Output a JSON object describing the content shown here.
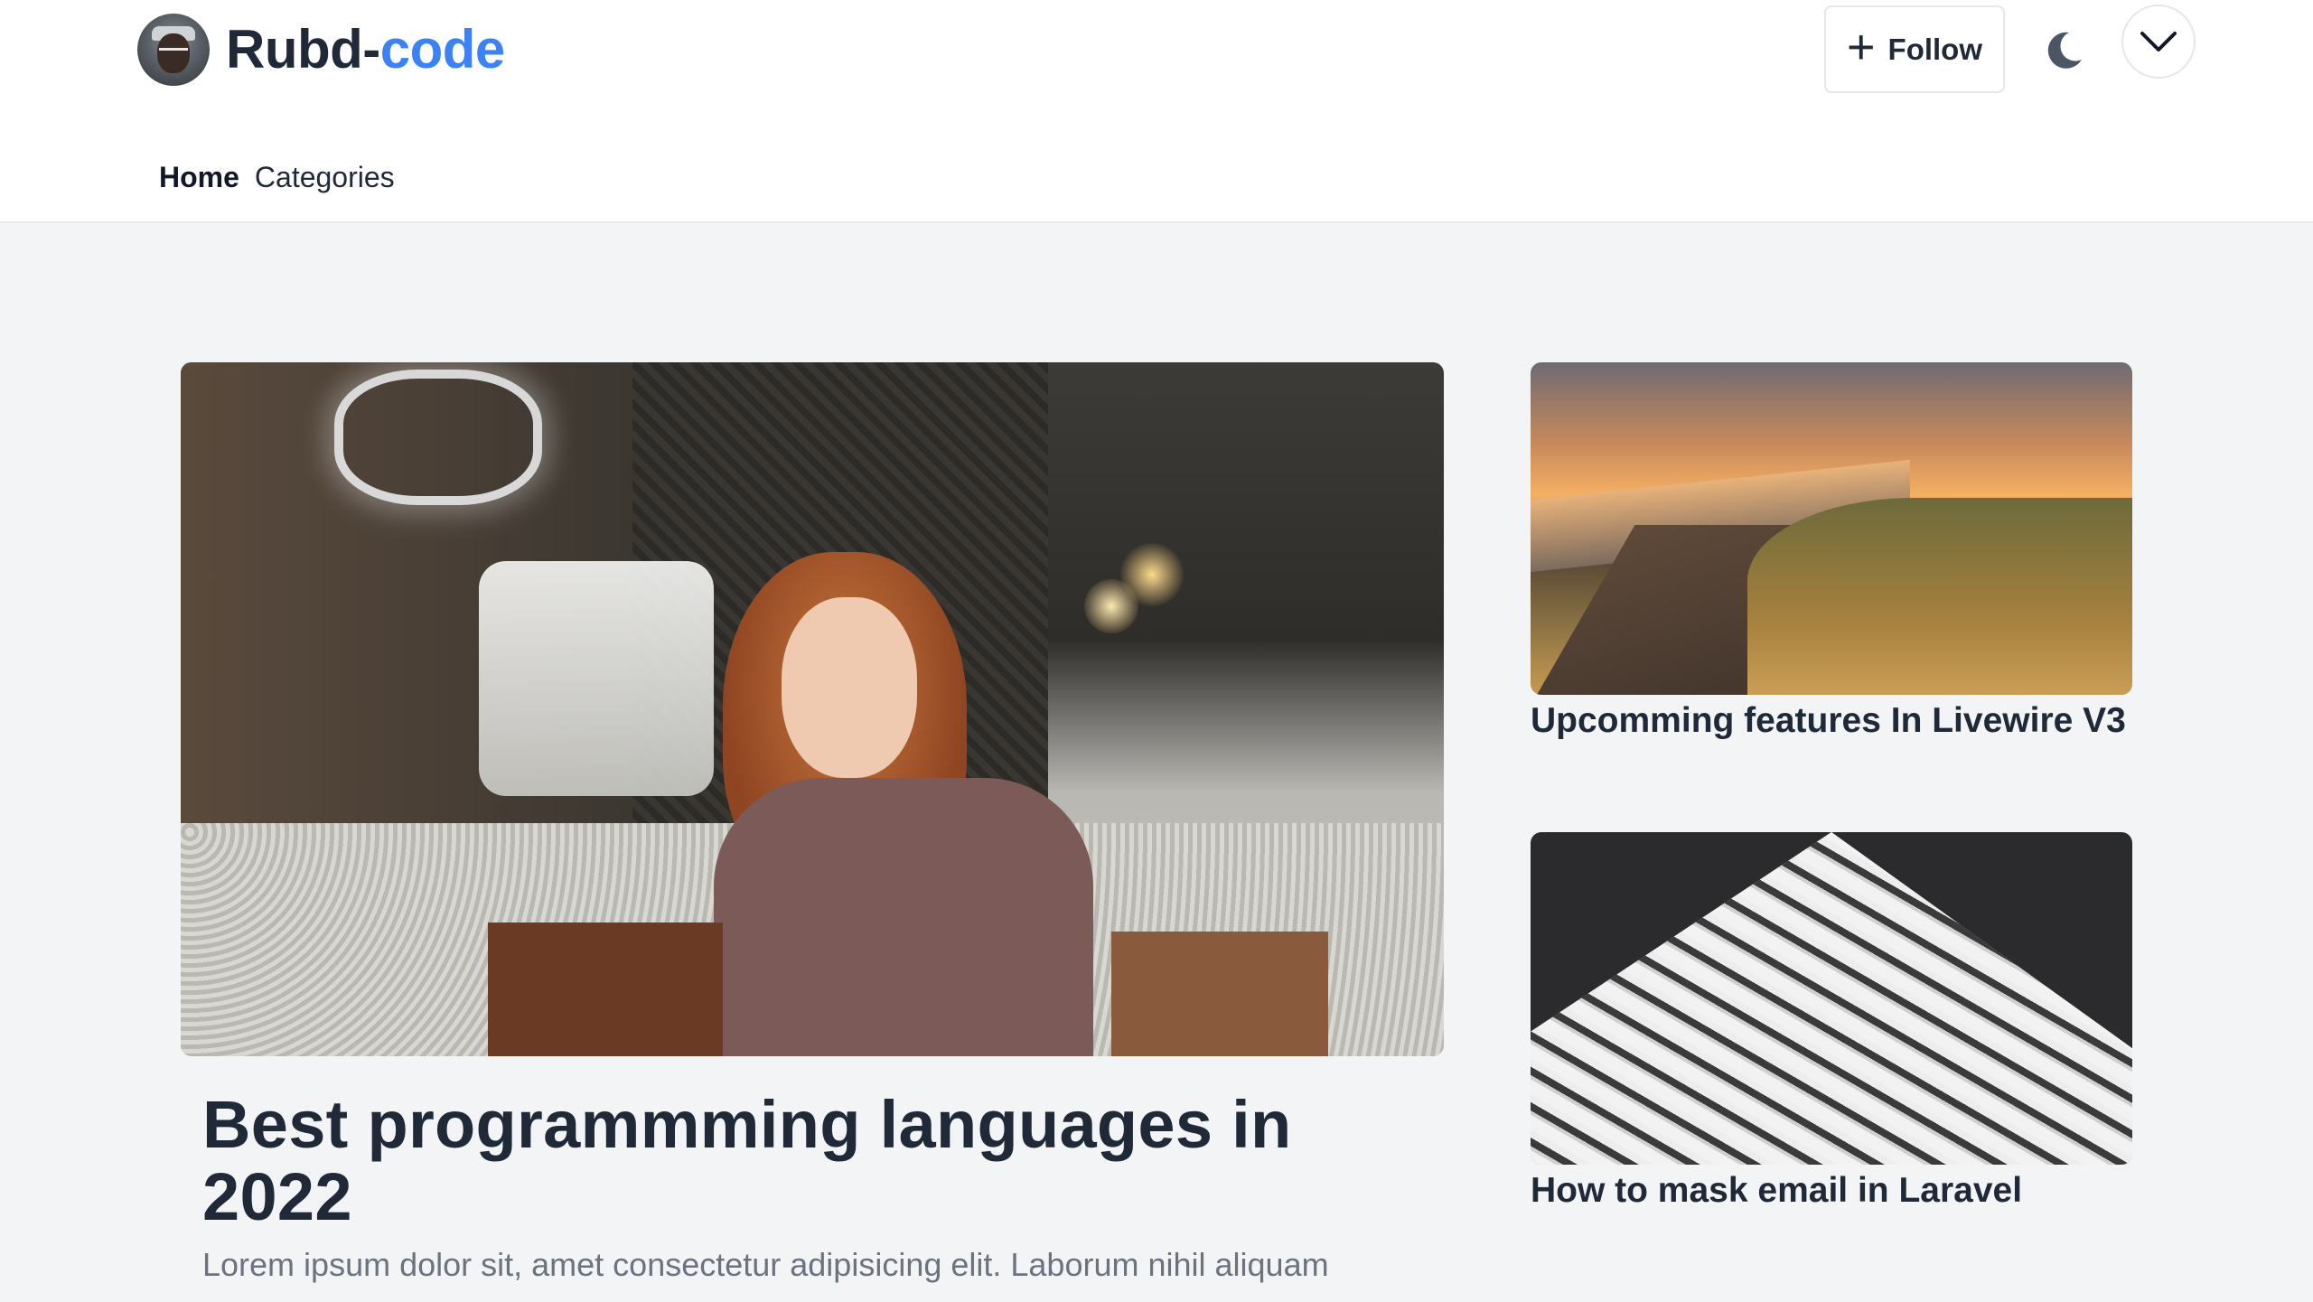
{
  "header": {
    "brand_part1": "Rubd-",
    "brand_part2": "code",
    "follow_label": "Follow",
    "plus_icon": "+",
    "theme_toggle_icon": "moon-icon",
    "menu_icon": "chevron-down-icon"
  },
  "nav": {
    "items": [
      {
        "label": "Home",
        "active": true
      },
      {
        "label": "Categories",
        "active": false
      }
    ]
  },
  "featured": {
    "title": "Best programmming languages in 2022",
    "excerpt": "Lorem ipsum dolor sit, amet consectetur adipisicing elit. Laborum nihil aliquam"
  },
  "side_posts": [
    {
      "title": "Upcomming features In Livewire V3"
    },
    {
      "title": "How to mask email in Laravel"
    }
  ],
  "colors": {
    "accent": "#3b82f6",
    "background": "#f3f4f6",
    "text": "#1f2937",
    "muted": "#6b7280"
  }
}
